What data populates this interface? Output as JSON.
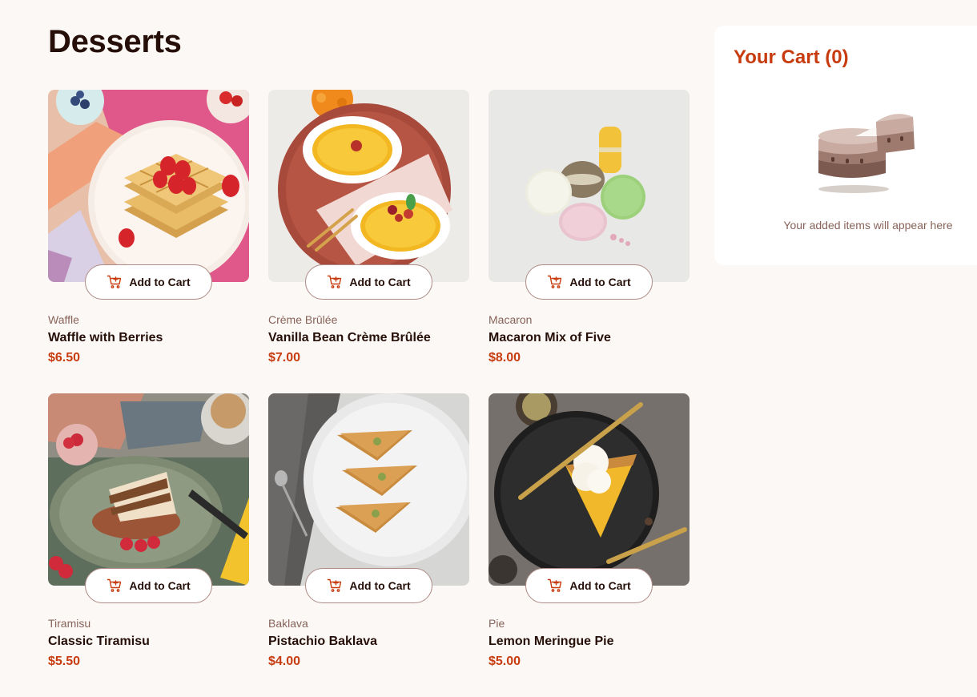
{
  "page": {
    "title": "Desserts"
  },
  "products": [
    {
      "category": "Waffle",
      "name": "Waffle with Berries",
      "price": "$6.50",
      "button_label": "Add to Cart",
      "image": "waffle-photo"
    },
    {
      "category": "Crème Brûlée",
      "name": "Vanilla Bean Crème Brûlée",
      "price": "$7.00",
      "button_label": "Add to Cart",
      "image": "creme-brulee-photo"
    },
    {
      "category": "Macaron",
      "name": "Macaron Mix of Five",
      "price": "$8.00",
      "button_label": "Add to Cart",
      "image": "macaron-photo"
    },
    {
      "category": "Tiramisu",
      "name": "Classic Tiramisu",
      "price": "$5.50",
      "button_label": "Add to Cart",
      "image": "tiramisu-photo"
    },
    {
      "category": "Baklava",
      "name": "Pistachio Baklava",
      "price": "$4.00",
      "button_label": "Add to Cart",
      "image": "baklava-photo"
    },
    {
      "category": "Pie",
      "name": "Lemon Meringue Pie",
      "price": "$5.00",
      "button_label": "Add to Cart",
      "image": "lemon-pie-photo"
    }
  ],
  "cart": {
    "title": "Your Cart (0)",
    "empty_message": "Your added items will appear here",
    "illustration": "empty-cake-illustration"
  },
  "colors": {
    "background": "#fcf8f5",
    "accent": "#c73b0f",
    "text_dark": "#260f08",
    "text_muted": "#87635a",
    "button_border": "#ad8a85"
  },
  "icons": {
    "add_to_cart": "cart-plus-icon"
  }
}
